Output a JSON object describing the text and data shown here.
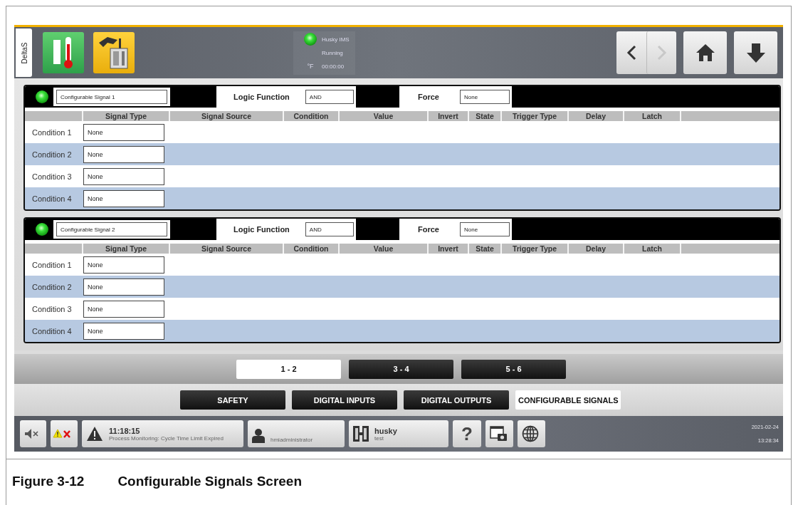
{
  "header": {
    "side_tab": "DeltaS",
    "quick_buttons": [
      {
        "kind": "temperature"
      },
      {
        "kind": "mold"
      }
    ],
    "status": {
      "indicator_on": true,
      "unit": "°F",
      "lines": [
        "Husky IMS",
        "Running",
        "00:00:00"
      ]
    },
    "nav_buttons": [
      {
        "kind": "back",
        "disabled": false
      },
      {
        "kind": "forward",
        "disabled": true
      },
      {
        "kind": "home",
        "disabled": false
      },
      {
        "kind": "down",
        "disabled": false
      }
    ]
  },
  "signals": [
    {
      "indicator_on": true,
      "name": "Configurable Signal 1",
      "logic_function_label": "Logic Function",
      "logic_function": "AND",
      "force_label": "Force",
      "force": "None",
      "columns": [
        "Signal Type",
        "Signal Source",
        "Condition",
        "Value",
        "Invert",
        "State",
        "Trigger Type",
        "Delay",
        "Latch"
      ],
      "rows": [
        {
          "label": "Condition 1",
          "signal_type": "None"
        },
        {
          "label": "Condition 2",
          "signal_type": "None"
        },
        {
          "label": "Condition 3",
          "signal_type": "None"
        },
        {
          "label": "Condition 4",
          "signal_type": "None"
        }
      ]
    },
    {
      "indicator_on": true,
      "name": "Configurable Signal 2",
      "logic_function_label": "Logic Function",
      "logic_function": "AND",
      "force_label": "Force",
      "force": "None",
      "columns": [
        "Signal Type",
        "Signal Source",
        "Condition",
        "Value",
        "Invert",
        "State",
        "Trigger Type",
        "Delay",
        "Latch"
      ],
      "rows": [
        {
          "label": "Condition 1",
          "signal_type": "None"
        },
        {
          "label": "Condition 2",
          "signal_type": "None"
        },
        {
          "label": "Condition 3",
          "signal_type": "None"
        },
        {
          "label": "Condition 4",
          "signal_type": "None"
        }
      ]
    }
  ],
  "page_tabs": [
    {
      "label": "1 - 2",
      "selected": true
    },
    {
      "label": "3 - 4",
      "selected": false
    },
    {
      "label": "5 - 6",
      "selected": false
    }
  ],
  "section_tabs": [
    {
      "label": "SAFETY",
      "selected": false
    },
    {
      "label": "DIGITAL INPUTS",
      "selected": false
    },
    {
      "label": "DIGITAL OUTPUTS",
      "selected": false
    },
    {
      "label": "CONFIGURABLE SIGNALS",
      "selected": true
    }
  ],
  "status_bar": {
    "alarm": {
      "time": "11:18:15",
      "message": "Process Monitoring: Cycle Time Limit Expired"
    },
    "user": "hmiadministrator",
    "machine": {
      "name": "husky",
      "sub": "test"
    },
    "help": "?",
    "date": "2021-02-24",
    "time": "13:28:34"
  },
  "caption": {
    "number": "Figure 3-12",
    "title": "Configurable Signals Screen"
  }
}
